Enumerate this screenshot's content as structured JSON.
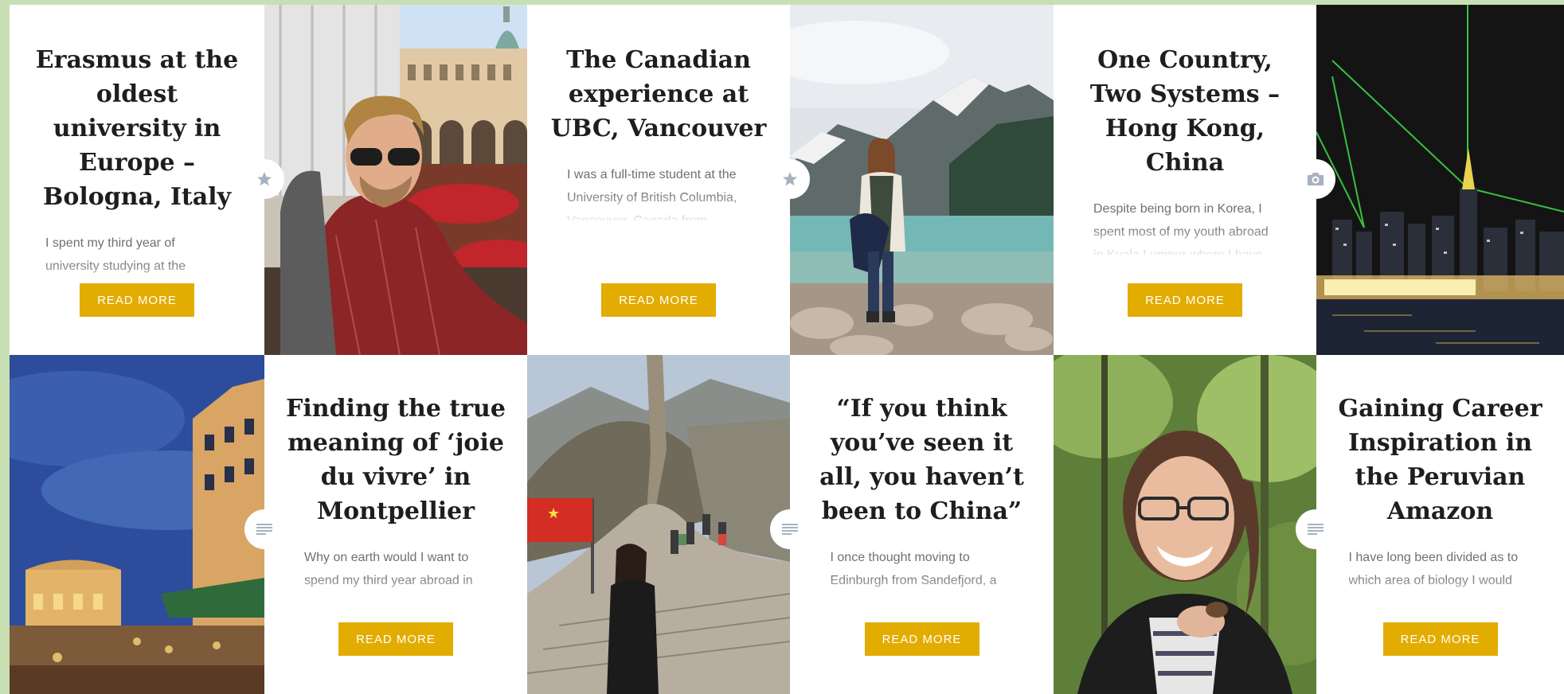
{
  "posts": [
    {
      "title": "Erasmus at the oldest university in Europe – Bologna, Italy",
      "excerpt": "I spent my third year of university studying at the",
      "read_more": "READ MORE",
      "format_icon": "star-icon"
    },
    {
      "title": "The Canadian experience at UBC, Vancouver",
      "excerpt": "I was a full-time student at the University of British Columbia, Vancouver, Canada from",
      "read_more": "READ MORE",
      "format_icon": "star-icon"
    },
    {
      "title": "One Country, Two Systems – Hong Kong, China",
      "excerpt": "Despite being born in Korea, I spent most of my youth abroad in Kuala Lumpur where I have",
      "read_more": "READ MORE",
      "format_icon": "camera-icon"
    },
    {
      "title": "Finding the true meaning of ‘joie du vivre’ in Montpellier",
      "excerpt": "Why on earth would I want to spend my third year abroad in",
      "read_more": "READ MORE",
      "format_icon": "text-lines-icon"
    },
    {
      "title": "“If you think you’ve seen it all, you haven’t been to China”",
      "excerpt": "I once thought moving to Edinburgh from Sandefjord, a",
      "read_more": "READ MORE",
      "format_icon": "text-lines-icon"
    },
    {
      "title": "Gaining Career Inspiration in the Peruvian Amazon",
      "excerpt": "I have long been divided as to which area of biology I would",
      "read_more": "READ MORE",
      "format_icon": "text-lines-icon"
    }
  ],
  "colors": {
    "page_border": "#c8dfb4",
    "button": "#e2ac00",
    "title": "#1e1e1e",
    "excerpt": "#707070",
    "badge_icon": "#a7b2c0"
  }
}
